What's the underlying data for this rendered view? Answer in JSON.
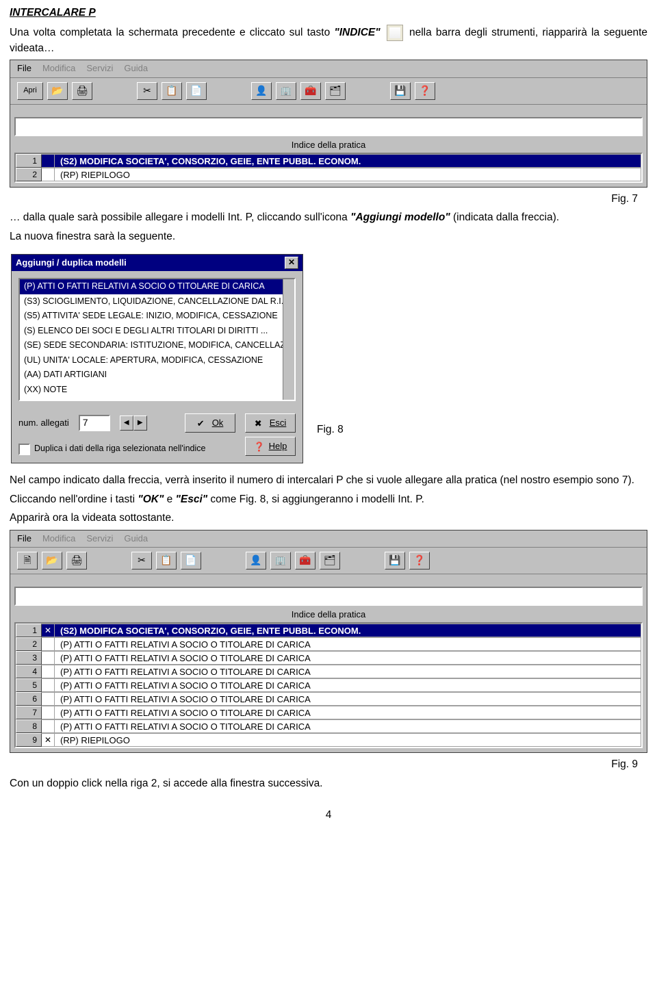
{
  "headings": {
    "title": "INTERCALARE P"
  },
  "paragraphs": {
    "p1a": "Una volta completata la schermata precedente e cliccato sul tasto ",
    "p1b": "\"INDICE\"",
    "p1c": " nella barra degli strumenti, riapparirà la seguente videata…",
    "p2a": "… dalla quale sarà possibile allegare i modelli Int. P, cliccando sull'icona ",
    "p2b": "\"Aggiungi modello\"",
    "p2c": " (indicata dalla freccia).",
    "p3": "La nuova finestra sarà la seguente.",
    "p4": "Nel campo indicato dalla freccia, verrà inserito il numero di  intercalari P che si vuole allegare alla pratica (nel nostro esempio sono 7).",
    "p5a": "Cliccando nell'ordine i tasti ",
    "p5b": "\"OK\"",
    "p5c": " e ",
    "p5d": "\"Esci\"",
    "p5e": " come Fig. 8, si aggiungeranno i modelli Int. P.",
    "p6": "Apparirà ora la videata sottostante.",
    "p7": "Con un doppio click nella riga 2, si accede alla finestra successiva."
  },
  "figlabels": {
    "f7": "Fig. 7",
    "f8": "Fig. 8",
    "f9": "Fig. 9"
  },
  "menubar": [
    "File",
    "Modifica",
    "Servizi",
    "Guida"
  ],
  "apri_label": "Apri",
  "ui1": {
    "sunken_placeholder": "",
    "index_title": "Indice della pratica",
    "rows": [
      {
        "n": "1",
        "ck": "",
        "txt": "(S2) MODIFICA  SOCIETA', CONSORZIO, GEIE, ENTE PUBBL. ECONOM.",
        "sel": true
      },
      {
        "n": "2",
        "ck": "",
        "txt": "(RP) RIEPILOGO",
        "sel": false
      }
    ]
  },
  "dialog": {
    "title": "Aggiungi / duplica modelli",
    "items": [
      "(P) ATTI O FATTI RELATIVI A SOCIO O TITOLARE DI CARICA",
      "(S3) SCIOGLIMENTO, LIQUIDAZIONE, CANCELLAZIONE DAL R.I.",
      "(S5) ATTIVITA' SEDE LEGALE: INIZIO, MODIFICA, CESSAZIONE",
      "(S) ELENCO DEI SOCI E DEGLI ALTRI TITOLARI DI DIRITTI ...",
      "(SE) SEDE SECONDARIA: ISTITUZIONE, MODIFICA, CANCELLAZIONE",
      "(UL) UNITA' LOCALE: APERTURA, MODIFICA, CESSAZIONE",
      "(AA) DATI ARTIGIANI",
      "(XX) NOTE"
    ],
    "num_label": "num. allegati",
    "num_value": "7",
    "ok": "Ok",
    "esci": "Esci",
    "help": "Help",
    "dup": "Duplica i dati della riga selezionata nell'indice"
  },
  "ui3": {
    "index_title": "Indice della pratica",
    "rows": [
      {
        "n": "1",
        "ck": "✕",
        "txt": "(S2) MODIFICA  SOCIETA', CONSORZIO, GEIE, ENTE PUBBL. ECONOM.",
        "sel": true
      },
      {
        "n": "2",
        "ck": "",
        "txt": "(P)   ATTI O FATTI RELATIVI A SOCIO O TITOLARE DI CARICA",
        "sel": false
      },
      {
        "n": "3",
        "ck": "",
        "txt": "(P)   ATTI O FATTI RELATIVI A SOCIO O TITOLARE DI CARICA",
        "sel": false
      },
      {
        "n": "4",
        "ck": "",
        "txt": "(P)   ATTI O FATTI RELATIVI A SOCIO O TITOLARE DI CARICA",
        "sel": false
      },
      {
        "n": "5",
        "ck": "",
        "txt": "(P)   ATTI O FATTI RELATIVI A SOCIO O TITOLARE DI CARICA",
        "sel": false
      },
      {
        "n": "6",
        "ck": "",
        "txt": "(P)   ATTI O FATTI RELATIVI A SOCIO O TITOLARE DI CARICA",
        "sel": false
      },
      {
        "n": "7",
        "ck": "",
        "txt": "(P)   ATTI O FATTI RELATIVI A SOCIO O TITOLARE DI CARICA",
        "sel": false
      },
      {
        "n": "8",
        "ck": "",
        "txt": "(P)   ATTI O FATTI RELATIVI A SOCIO O TITOLARE DI CARICA",
        "sel": false
      },
      {
        "n": "9",
        "ck": "✕",
        "txt": "(RP) RIEPILOGO",
        "sel": false
      }
    ]
  },
  "pagenum": "4"
}
